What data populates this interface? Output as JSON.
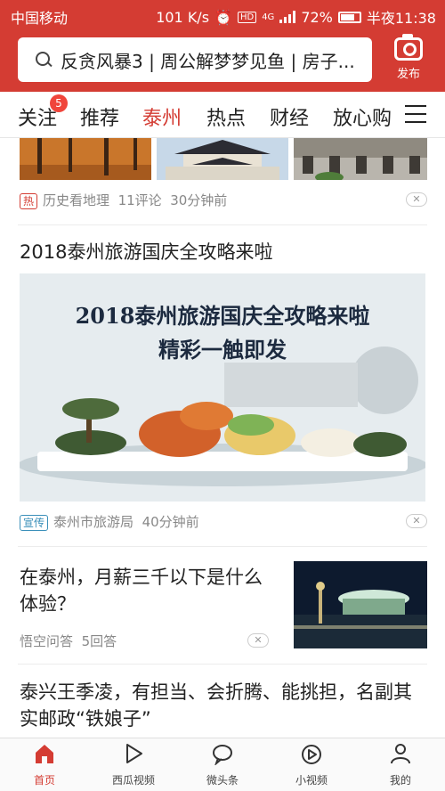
{
  "status": {
    "carrier": "中国移动",
    "speed": "101 K/s",
    "network": "4G",
    "battery": "72%",
    "time": "半夜11:38"
  },
  "header": {
    "search_text": "反贪风暴3 | 周公解梦梦见鱼 | 房子...",
    "publish_label": "发布"
  },
  "tabs": [
    {
      "label": "关注",
      "badge": "5"
    },
    {
      "label": "推荐"
    },
    {
      "label": "泰州",
      "active": true
    },
    {
      "label": "热点"
    },
    {
      "label": "财经"
    },
    {
      "label": "放心购"
    }
  ],
  "feed": {
    "item1": {
      "tag": "热",
      "source": "历史看地理",
      "comments": "11评论",
      "time": "30分钟前"
    },
    "item2": {
      "title": "2018泰州旅游国庆全攻略来啦",
      "banner_line1": "2018泰州旅游国庆全攻略来啦",
      "banner_line2": "精彩一触即发",
      "tag": "宣传",
      "source": "泰州市旅游局",
      "time": "40分钟前"
    },
    "item3": {
      "title": "在泰州，月薪三千以下是什么体验？",
      "source": "悟空问答",
      "answers": "5回答"
    },
    "item4": {
      "title": "泰兴王季凌，有担当、会折腾、能挑担，名副其实邮政“铁娘子”"
    }
  },
  "bottom_nav": [
    {
      "label": "首页",
      "icon": "home-icon",
      "active": true
    },
    {
      "label": "西瓜视频",
      "icon": "play-icon"
    },
    {
      "label": "微头条",
      "icon": "chat-bubble-icon"
    },
    {
      "label": "小视频",
      "icon": "short-video-icon"
    },
    {
      "label": "我的",
      "icon": "person-icon"
    }
  ],
  "colors": {
    "brand": "#d43c33",
    "tag_ad": "#3a8fb9"
  }
}
